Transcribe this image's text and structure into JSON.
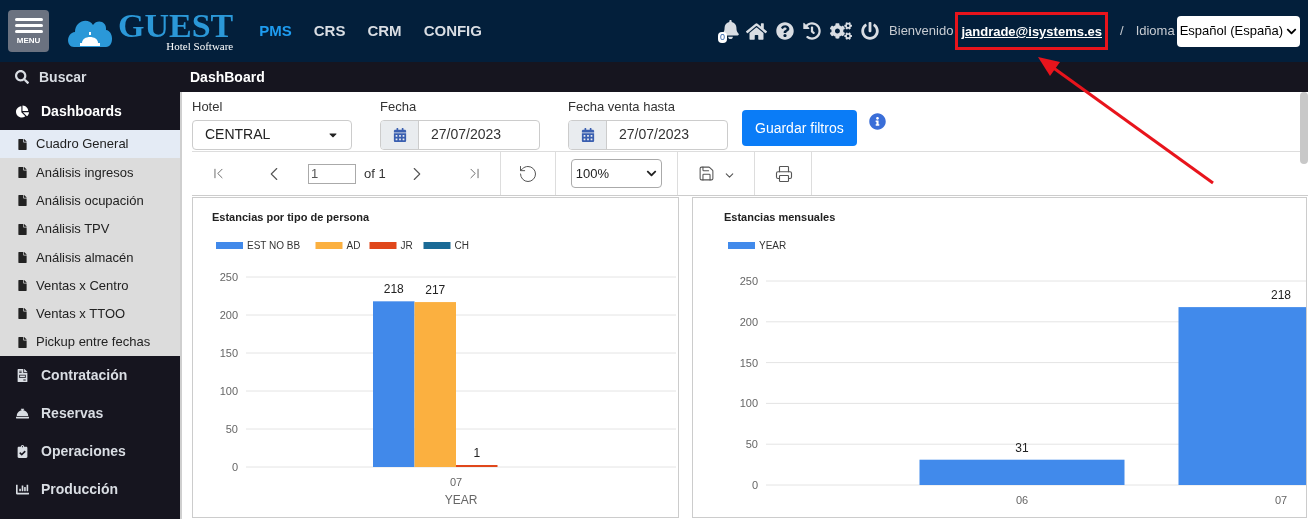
{
  "header": {
    "menu_label": "MENU",
    "logo_title": "GUEST",
    "logo_subtitle": "Hotel Software",
    "nav": [
      {
        "label": "PMS",
        "selected": true
      },
      {
        "label": "CRS",
        "selected": false
      },
      {
        "label": "CRM",
        "selected": false
      },
      {
        "label": "CONFIG",
        "selected": false
      }
    ],
    "notification_count": "0",
    "welcome": "Bienvenido",
    "user": "jandrade@isystems.es",
    "separator": "/",
    "language_label": "Idioma",
    "language": "Español (España)"
  },
  "search": {
    "label": "Buscar"
  },
  "page_title": "DashBoard",
  "sidebar": {
    "items": [
      {
        "label": "Dashboards",
        "expanded": true,
        "children": [
          {
            "label": "Cuadro General",
            "selected": true
          },
          {
            "label": "Análisis ingresos",
            "selected": false
          },
          {
            "label": "Análisis ocupación",
            "selected": false
          },
          {
            "label": "Análisis TPV",
            "selected": false
          },
          {
            "label": "Análisis almacén",
            "selected": false
          },
          {
            "label": "Ventas x Centro",
            "selected": false
          },
          {
            "label": "Ventas x TTOO",
            "selected": false
          },
          {
            "label": "Pickup entre fechas",
            "selected": false
          }
        ]
      },
      {
        "label": "Contratación",
        "expanded": false
      },
      {
        "label": "Reservas",
        "expanded": false
      },
      {
        "label": "Operaciones",
        "expanded": false
      },
      {
        "label": "Producción",
        "expanded": false
      }
    ]
  },
  "filters": {
    "hotel": {
      "label": "Hotel",
      "value": "CENTRAL"
    },
    "date": {
      "label": "Fecha",
      "value": "27/07/2023"
    },
    "sale_date": {
      "label": "Fecha venta hasta",
      "value": "27/07/2023"
    },
    "save_button": "Guardar filtros"
  },
  "toolbar": {
    "page": "1",
    "page_total": "of 1",
    "zoom": "100%"
  },
  "charts": [
    {
      "chart_data": {
        "type": "bar",
        "title": "Estancias por tipo de persona",
        "xlabel": "YEAR",
        "categories": [
          "07"
        ],
        "series": [
          {
            "name": "EST NO BB",
            "color": "#4189ea",
            "values": [
              218
            ]
          },
          {
            "name": "AD",
            "color": "#fbb040",
            "values": [
              217
            ]
          },
          {
            "name": "JR",
            "color": "#e0471b",
            "values": [
              1
            ]
          },
          {
            "name": "CH",
            "color": "#1a6a96",
            "values": [
              null
            ]
          }
        ],
        "ylim": [
          0,
          250
        ],
        "yticks": [
          0,
          50,
          100,
          150,
          200,
          250
        ],
        "data_labels": true,
        "grid": true,
        "legend": "top"
      }
    },
    {
      "chart_data": {
        "type": "bar",
        "title": "Estancias mensuales",
        "categories": [
          "06",
          "07"
        ],
        "series": [
          {
            "name": "YEAR",
            "color": "#418aeb",
            "values": [
              31,
              218
            ]
          }
        ],
        "ylim": [
          0,
          250
        ],
        "yticks": [
          0,
          50,
          100,
          150,
          200,
          250
        ],
        "data_labels": true,
        "grid": true,
        "legend": "top"
      }
    }
  ]
}
